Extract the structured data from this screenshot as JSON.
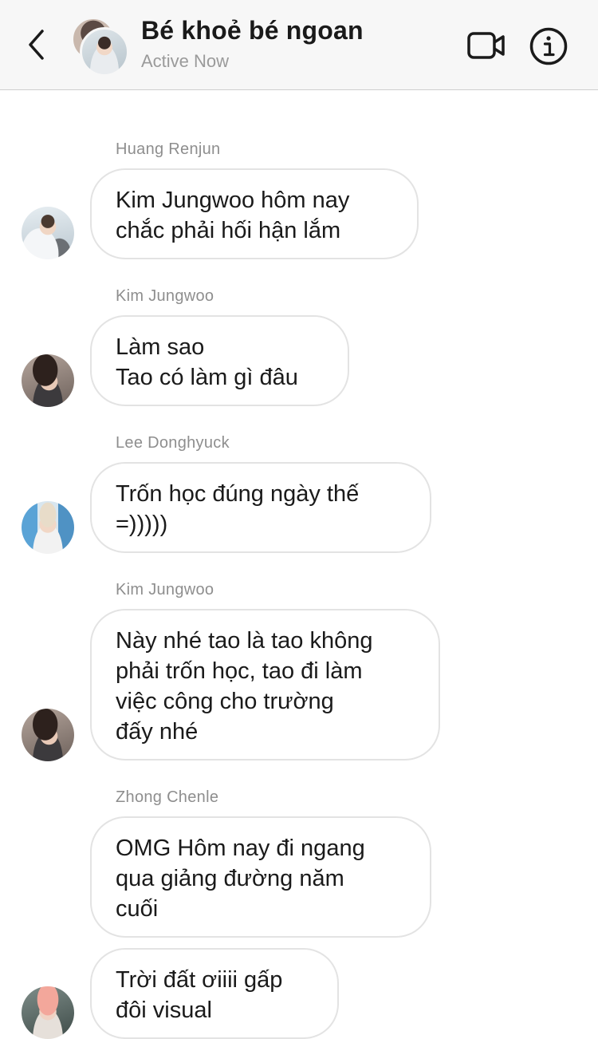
{
  "header": {
    "title": "Bé khoẻ bé ngoan",
    "status": "Active Now"
  },
  "messages": [
    {
      "sender": "Huang Renjun",
      "lines": [
        "Kim Jungwoo hôm nay",
        "chắc phải hối hận lắm"
      ]
    },
    {
      "sender": "Kim Jungwoo",
      "lines": [
        "Làm sao",
        "Tao có làm gì đâu"
      ]
    },
    {
      "sender": "Lee Donghyuck",
      "lines": [
        "Trốn học đúng ngày thế",
        "=)))))"
      ]
    },
    {
      "sender": "Kim Jungwoo",
      "lines": [
        "Này nhé tao là tao không",
        "phải trốn học, tao đi làm",
        "việc công cho trường",
        "đấy nhé"
      ]
    },
    {
      "sender": "Zhong Chenle",
      "lines": [
        "OMG Hôm nay đi ngang",
        "qua giảng đường năm",
        "cuối"
      ]
    },
    {
      "sender": "",
      "lines": [
        "Trời đất ơiiii gấp",
        "đôi visual"
      ]
    }
  ]
}
